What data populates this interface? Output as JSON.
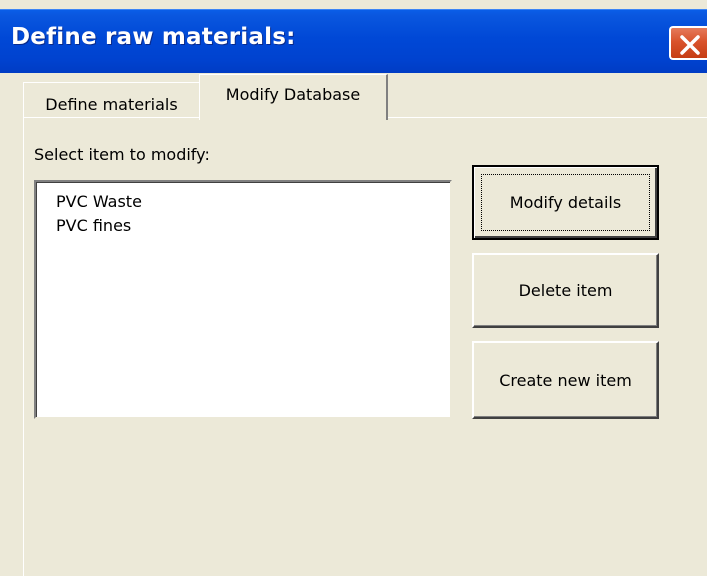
{
  "window": {
    "title": "Define raw materials:"
  },
  "tabs": [
    {
      "label": "Define materials",
      "active": false
    },
    {
      "label": "Modify Database",
      "active": true
    }
  ],
  "panel": {
    "select_label": "Select item to modify:",
    "items": [
      "PVC Waste",
      "PVC fines"
    ]
  },
  "buttons": {
    "modify": "Modify details",
    "delete": "Delete item",
    "create": "Create new item"
  },
  "colors": {
    "titlebar": "#0048d6",
    "close_button": "#d9532c",
    "dialog_background": "#ece9d8"
  },
  "icons": {
    "close": "close-x-icon"
  }
}
